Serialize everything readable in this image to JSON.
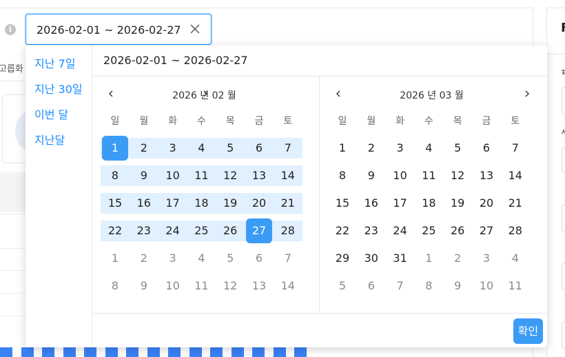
{
  "background": {
    "info_icon": "info-icon",
    "clipped_label": "고릅화",
    "right_panel_char": "F",
    "right_labels": [
      "제",
      "상"
    ]
  },
  "date_input": {
    "value": "2026-02-01 ~ 2026-02-27",
    "clear_icon": "close-icon"
  },
  "picker": {
    "range_text": "2026-02-01 ~ 2026-02-27",
    "shortcuts": [
      "지난 7일",
      "지난 30일",
      "이번 달",
      "지난달"
    ],
    "confirm_label": "확인",
    "accent": "#3b9cf6",
    "range_bg": "#e1f0fe",
    "weekdays": [
      "일",
      "월",
      "화",
      "수",
      "목",
      "금",
      "토"
    ],
    "months": [
      {
        "title": "2026 년 02 월",
        "weeks": [
          [
            "1",
            "2",
            "3",
            "4",
            "5",
            "6",
            "7"
          ],
          [
            "8",
            "9",
            "10",
            "11",
            "12",
            "13",
            "14"
          ],
          [
            "15",
            "16",
            "17",
            "18",
            "19",
            "20",
            "21"
          ],
          [
            "22",
            "23",
            "24",
            "25",
            "26",
            "27",
            "28"
          ],
          [
            "1",
            "2",
            "3",
            "4",
            "5",
            "6",
            "7"
          ],
          [
            "8",
            "9",
            "10",
            "11",
            "12",
            "13",
            "14"
          ]
        ],
        "in_month_weeks": 4,
        "range_start": "1",
        "range_end": "27"
      },
      {
        "title": "2026 년 03 월",
        "weeks": [
          [
            "1",
            "2",
            "3",
            "4",
            "5",
            "6",
            "7"
          ],
          [
            "8",
            "9",
            "10",
            "11",
            "12",
            "13",
            "14"
          ],
          [
            "15",
            "16",
            "17",
            "18",
            "19",
            "20",
            "21"
          ],
          [
            "22",
            "23",
            "24",
            "25",
            "26",
            "27",
            "28"
          ],
          [
            "29",
            "30",
            "31",
            "1",
            "2",
            "3",
            "4"
          ],
          [
            "5",
            "6",
            "7",
            "8",
            "9",
            "10",
            "11"
          ]
        ],
        "in_month_weeks": 5,
        "in_month_last_row_days": 3
      }
    ]
  }
}
